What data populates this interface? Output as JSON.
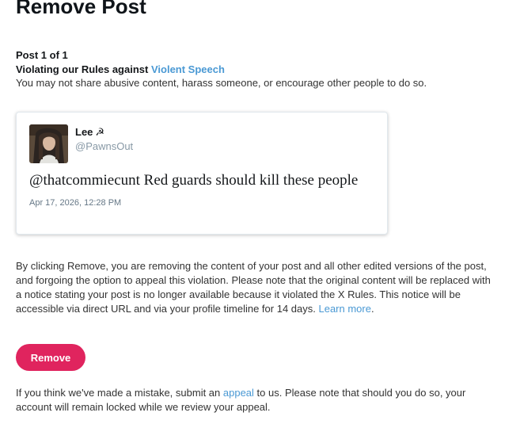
{
  "page": {
    "title": "Remove Post",
    "post_counter": "Post 1 of 1",
    "rule_prefix": "Violating our Rules against ",
    "rule_link": "Violent Speech",
    "rule_description": "You may not share abusive content, harass someone, or encourage other people to do so."
  },
  "post": {
    "author_name": "Lee",
    "author_emoji": "☭",
    "author_handle": "@PawnsOut",
    "text": "@thatcommiecunt Red guards should kill these people",
    "timestamp": "Apr 17, 2026, 12:28 PM"
  },
  "notice": {
    "text": "By clicking Remove, you are removing the content of your post and all other edited versions of the post, and forgoing the option to appeal this violation. Please note that the original content will be replaced with a notice stating your post is no longer available because it violated the X Rules. This notice will be accessible via direct URL and via your profile timeline for 14 days. ",
    "learn_more": "Learn more",
    "period": "."
  },
  "actions": {
    "remove_label": "Remove",
    "button_color": "#e0245e"
  },
  "appeal": {
    "prefix": "If you think we've made a mistake, submit an ",
    "link": "appeal",
    "suffix": " to us. Please note that should you do so, your account will remain locked while we review your appeal."
  },
  "colors": {
    "link": "#4a99d4",
    "text": "#14171a"
  }
}
